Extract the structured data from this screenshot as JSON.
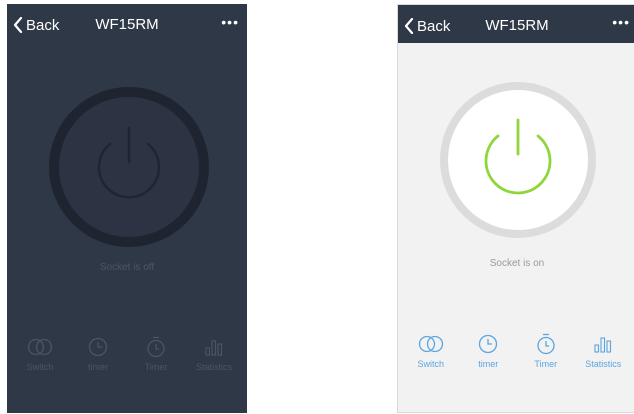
{
  "colors": {
    "off_background": "#2f3847",
    "off_muted": "#4a5566",
    "on_background": "#f2f2f2",
    "on_accent_green": "#8ed63b",
    "on_icon_blue": "#5aa5e0"
  },
  "screen_off": {
    "nav": {
      "back_label": "Back",
      "title": "WF15RM",
      "more_label": "•••"
    },
    "status_text": "Socket is off",
    "bottom_items": [
      {
        "icon": "switch-icon",
        "label": "Switch"
      },
      {
        "icon": "clock-icon",
        "label": "timer"
      },
      {
        "icon": "stopwatch-icon",
        "label": "Timer"
      },
      {
        "icon": "bar-chart-icon",
        "label": "Statistics"
      }
    ]
  },
  "screen_on": {
    "nav": {
      "back_label": "Back",
      "title": "WF15RM",
      "more_label": "•••"
    },
    "status_text": "Socket is on",
    "bottom_items": [
      {
        "icon": "switch-icon",
        "label": "Switch"
      },
      {
        "icon": "clock-icon",
        "label": "timer"
      },
      {
        "icon": "stopwatch-icon",
        "label": "Timer"
      },
      {
        "icon": "bar-chart-icon",
        "label": "Statistics"
      }
    ]
  }
}
